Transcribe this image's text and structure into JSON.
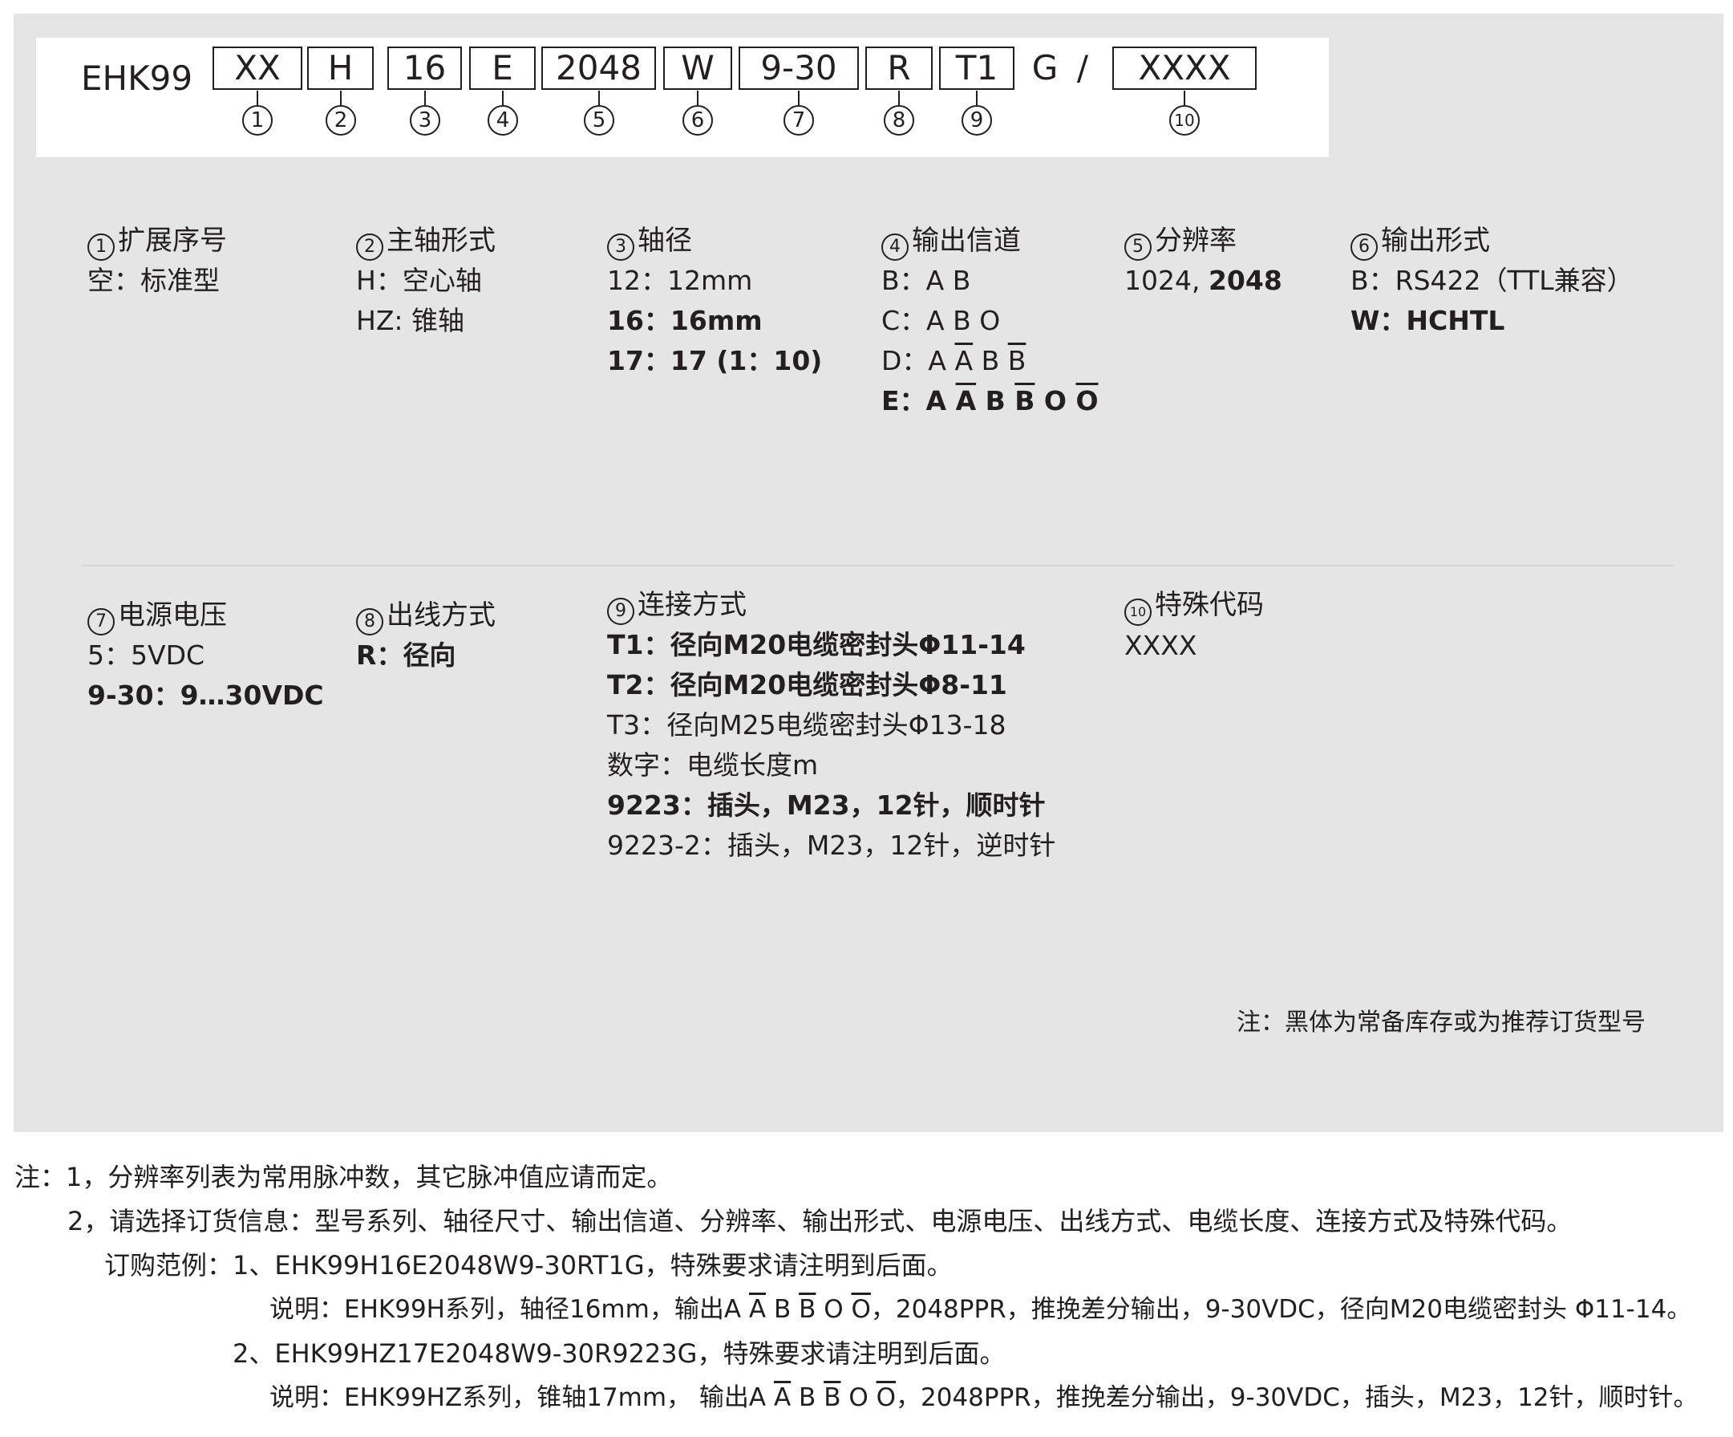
{
  "model_code": {
    "series": "EHK99",
    "segments": [
      {
        "value": "XX",
        "num": "1"
      },
      {
        "value": "H",
        "num": "2"
      },
      {
        "value": "16",
        "num": "3"
      },
      {
        "value": "E",
        "num": "4"
      },
      {
        "value": "2048",
        "num": "5"
      },
      {
        "value": "W",
        "num": "6"
      },
      {
        "value": "9-30",
        "num": "7"
      },
      {
        "value": "R",
        "num": "8"
      },
      {
        "value": "T1",
        "num": "9"
      },
      {
        "value": "G",
        "num": ""
      },
      {
        "value": "/",
        "num": ""
      },
      {
        "value": "XXXX",
        "num": "10"
      }
    ]
  },
  "options": {
    "ext": {
      "num": "1",
      "title": "扩展序号",
      "lines": [
        "空：标准型"
      ]
    },
    "shaft_type": {
      "num": "2",
      "title": "主轴形式",
      "lines": [
        "H：空心轴",
        "HZ: 锥轴"
      ]
    },
    "diameter": {
      "num": "3",
      "title": "轴径",
      "lines": [
        "12：12mm",
        "16：16mm",
        "17：17 (1：10)"
      ]
    },
    "channel": {
      "num": "4",
      "title": "输出信道",
      "B": {
        "label": "B：",
        "text": "A B"
      },
      "C": {
        "label": "C：",
        "text": "A B O"
      },
      "D": {
        "label": "D：",
        "p1": "A ",
        "ov1": "A",
        "p2": " B ",
        "ov2": "B"
      },
      "E": {
        "label": "E：",
        "p1": "A ",
        "ov1": "A",
        "p2": " B ",
        "ov2": "B",
        "p3": " O ",
        "ov3": "O"
      }
    },
    "resolution": {
      "num": "5",
      "title": "分辨率",
      "normal": "1024, ",
      "bold": "2048"
    },
    "output": {
      "num": "6",
      "title": "输出形式",
      "lines": [
        "B：RS422（TTL兼容）",
        "W：HCHTL"
      ]
    },
    "voltage": {
      "num": "7",
      "title": "电源电压",
      "lines": [
        "5：5VDC",
        "9-30：9…30VDC"
      ]
    },
    "cable_exit": {
      "num": "8",
      "title": "出线方式",
      "lines": [
        "R：径向"
      ]
    },
    "connection": {
      "num": "9",
      "title": "连接方式",
      "lines": [
        "T1：径向M20电缆密封头Φ11-14",
        "T2：径向M20电缆密封头Φ8-11",
        "T3：径向M25电缆密封头Φ13-18",
        "数字：电缆长度m",
        "9223：插头，M23，12针，顺时针",
        "9223-2：插头，M23，12针，逆时针"
      ]
    },
    "special": {
      "num": "10",
      "title": "特殊代码",
      "lines": [
        "XXXX"
      ]
    }
  },
  "panel_note": "注：黑体为常备库存或为推荐订货型号",
  "notes": {
    "n1": "注：1，分辨率列表为常用脉冲数，其它脉冲值应请而定。",
    "n2": "2，请选择订货信息：型号系列、轴径尺寸、输出信道、分辨率、输出形式、电源电压、出线方式、电缆长度、连接方式及特殊代码。",
    "ex_label": "订购范例：1、EHK99H16E2048W9-30RT1G，特殊要求请注明到后面。",
    "ex1": {
      "pre": "说明：EHK99H系列，轴径16mm，输出A ",
      "ov1": "A",
      "mid1": " B ",
      "ov2": "B",
      "mid2": " O ",
      "ov3": "O",
      "post": "，2048PPR，推挽差分输出，9-30VDC，径向M20电缆密封头 Φ11-14。"
    },
    "ex2_label": "2、EHK99HZ17E2048W9-30R9223G，特殊要求请注明到后面。",
    "ex2": {
      "pre": "说明：EHK99HZ系列，锥轴17mm， 输出A ",
      "ov1": "A",
      "mid1": " B ",
      "ov2": "B",
      "mid2": " O ",
      "ov3": "O",
      "post": "，2048PPR，推挽差分输出，9-30VDC，插头，M23，12针，顺时针。"
    }
  }
}
